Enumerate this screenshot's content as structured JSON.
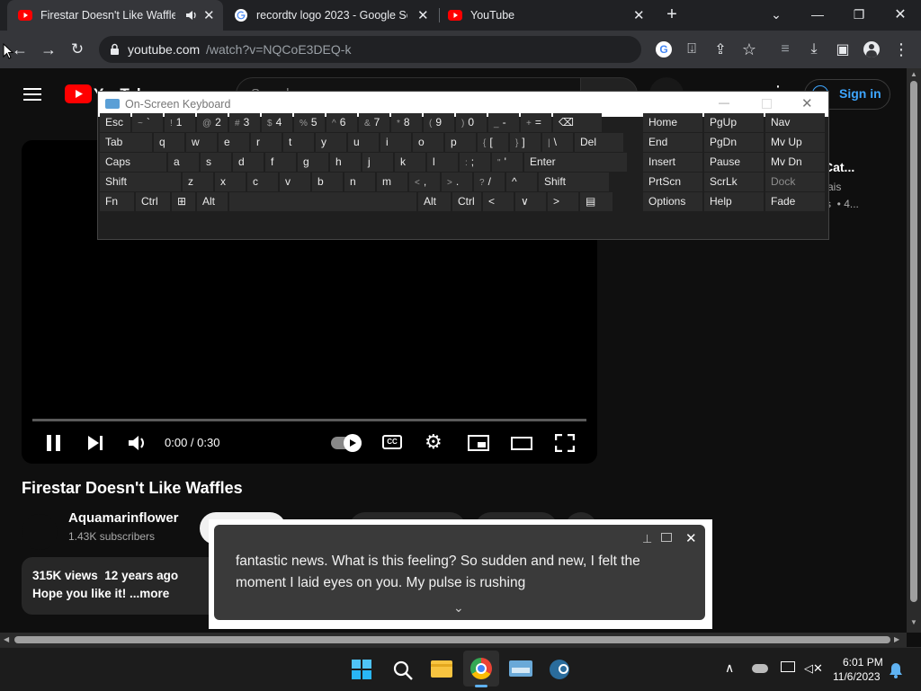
{
  "tabs": [
    {
      "title": "Firestar Doesn't Like Waffles"
    },
    {
      "title": "recordtv logo 2023 - Google Search"
    },
    {
      "title": "YouTube"
    }
  ],
  "address": {
    "domain": "youtube.com",
    "path": "/watch?v=NQCoE3DEQ-k"
  },
  "youtube": {
    "logo_text": "YouTube",
    "search_placeholder": "Search",
    "sign_in": "Sign in",
    "video_title": "Firestar Doesn't Like Waffles",
    "channel": "Aquamarinflower",
    "subscribers": "1.43K subscribers",
    "views_line": "315K views  12 years ago",
    "desc_line": "Hope you like it! ...more",
    "time": "0:00 / 0:30",
    "playback_progress": 0,
    "sidebar_frag1": "Cat...",
    "sidebar_frag2": "ais",
    "sidebar_frag3": "s  • 4..."
  },
  "osk": {
    "title": "On-Screen Keyboard",
    "rows": [
      [
        {
          "l": "Esc"
        },
        {
          "s": "~",
          "l": "`"
        },
        {
          "s": "!",
          "l": "1"
        },
        {
          "s": "@",
          "l": "2"
        },
        {
          "s": "#",
          "l": "3"
        },
        {
          "s": "$",
          "l": "4"
        },
        {
          "s": "%",
          "l": "5"
        },
        {
          "s": "^",
          "l": "6"
        },
        {
          "s": "&",
          "l": "7"
        },
        {
          "s": "*",
          "l": "8"
        },
        {
          "s": "(",
          "l": "9"
        },
        {
          "s": ")",
          "l": "0"
        },
        {
          "s": "_",
          "l": "-"
        },
        {
          "s": "+",
          "l": "="
        },
        {
          "l": "⌫"
        }
      ],
      [
        {
          "l": "Tab"
        },
        {
          "l": "q"
        },
        {
          "l": "w"
        },
        {
          "l": "e"
        },
        {
          "l": "r"
        },
        {
          "l": "t"
        },
        {
          "l": "y"
        },
        {
          "l": "u"
        },
        {
          "l": "i"
        },
        {
          "l": "o"
        },
        {
          "l": "p"
        },
        {
          "s": "{",
          "l": "["
        },
        {
          "s": "}",
          "l": "]"
        },
        {
          "s": "|",
          "l": "\\"
        },
        {
          "l": "Del"
        }
      ],
      [
        {
          "l": "Caps"
        },
        {
          "l": "a"
        },
        {
          "l": "s"
        },
        {
          "l": "d"
        },
        {
          "l": "f"
        },
        {
          "l": "g"
        },
        {
          "l": "h"
        },
        {
          "l": "j"
        },
        {
          "l": "k"
        },
        {
          "l": "l"
        },
        {
          "s": ":",
          "l": ";"
        },
        {
          "s": "\"",
          "l": "'"
        },
        {
          "l": "Enter"
        }
      ],
      [
        {
          "l": "Shift"
        },
        {
          "l": "z"
        },
        {
          "l": "x"
        },
        {
          "l": "c"
        },
        {
          "l": "v"
        },
        {
          "l": "b"
        },
        {
          "l": "n"
        },
        {
          "l": "m"
        },
        {
          "s": "<",
          "l": ","
        },
        {
          "s": ">",
          "l": "."
        },
        {
          "s": "?",
          "l": "/"
        },
        {
          "l": "^"
        },
        {
          "l": "Shift"
        }
      ],
      [
        {
          "l": "Fn"
        },
        {
          "l": "Ctrl"
        },
        {
          "l": "⊞"
        },
        {
          "l": "Alt"
        },
        {
          "l": ""
        },
        {
          "l": "Alt"
        },
        {
          "l": "Ctrl"
        },
        {
          "l": "<"
        },
        {
          "l": "∨"
        },
        {
          "l": ">"
        },
        {
          "l": "▤"
        }
      ]
    ],
    "nav": [
      [
        "Home",
        "PgUp",
        "Nav"
      ],
      [
        "End",
        "PgDn",
        "Mv Up"
      ],
      [
        "Insert",
        "Pause",
        "Mv Dn"
      ],
      [
        "PrtScn",
        "ScrLk",
        "Dock"
      ],
      [
        "Options",
        "Help",
        "Fade"
      ]
    ]
  },
  "caption": {
    "line1": "fantastic news. What is this feeling? So sudden and new, I felt the",
    "line2": "moment I laid eyes on you. My pulse is rushing"
  },
  "clock": {
    "time": "6:01 PM",
    "date": "11/6/2023"
  },
  "colors": {
    "youtube_red": "#ff0000",
    "sign_in_blue": "#3ea6ff",
    "chrome_dark": "#35363a"
  }
}
